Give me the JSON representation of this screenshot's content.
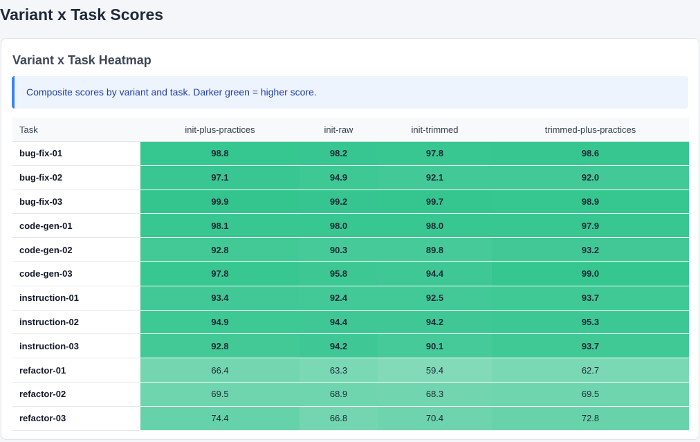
{
  "page": {
    "title": "Variant x Task Scores"
  },
  "card": {
    "title": "Variant x Task Heatmap",
    "info": "Composite scores by variant and task. Darker green = higher score."
  },
  "colors": {
    "info_accent": "#3b82f6",
    "heat_high": "#34c58f",
    "heat_low": "#8adcbd"
  },
  "table": {
    "headers": [
      "Task",
      "init-plus-practices",
      "init-raw",
      "init-trimmed",
      "trimmed-plus-practices"
    ],
    "rows": [
      {
        "task": "bug-fix-01",
        "scores": [
          "98.8",
          "98.2",
          "97.8",
          "98.6"
        ]
      },
      {
        "task": "bug-fix-02",
        "scores": [
          "97.1",
          "94.9",
          "92.1",
          "92.0"
        ]
      },
      {
        "task": "bug-fix-03",
        "scores": [
          "99.9",
          "99.2",
          "99.7",
          "98.9"
        ]
      },
      {
        "task": "code-gen-01",
        "scores": [
          "98.1",
          "98.0",
          "98.0",
          "97.9"
        ]
      },
      {
        "task": "code-gen-02",
        "scores": [
          "92.8",
          "90.3",
          "89.8",
          "93.2"
        ]
      },
      {
        "task": "code-gen-03",
        "scores": [
          "97.8",
          "95.8",
          "94.4",
          "99.0"
        ]
      },
      {
        "task": "instruction-01",
        "scores": [
          "93.4",
          "92.4",
          "92.5",
          "93.7"
        ]
      },
      {
        "task": "instruction-02",
        "scores": [
          "94.9",
          "94.4",
          "94.2",
          "95.3"
        ]
      },
      {
        "task": "instruction-03",
        "scores": [
          "92.8",
          "94.2",
          "90.1",
          "93.7"
        ]
      },
      {
        "task": "refactor-01",
        "scores": [
          "66.4",
          "63.3",
          "59.4",
          "62.7"
        ]
      },
      {
        "task": "refactor-02",
        "scores": [
          "69.5",
          "68.9",
          "68.3",
          "69.5"
        ]
      },
      {
        "task": "refactor-03",
        "scores": [
          "74.4",
          "66.8",
          "70.4",
          "72.8"
        ]
      }
    ]
  }
}
